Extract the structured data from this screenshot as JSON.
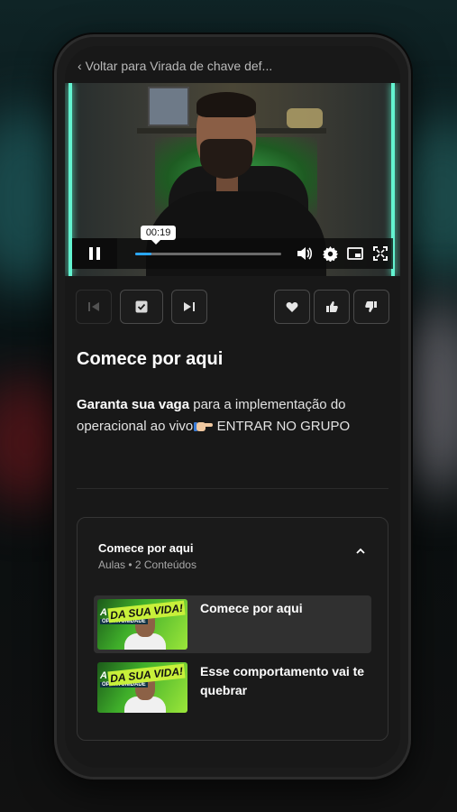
{
  "header": {
    "back_label": "Voltar para Virada de chave def..."
  },
  "video": {
    "current_time": "00:19",
    "progress": 0.11
  },
  "actions": {
    "prev": "previous-lesson",
    "complete": "mark-complete",
    "next": "next-lesson",
    "favorite": "favorite",
    "like": "like",
    "dislike": "dislike"
  },
  "lesson": {
    "title": "Comece por aqui",
    "description_bold": "Garanta sua vaga",
    "description_rest": " para a implementação do operacional ao vivo",
    "description_cta": " ENTRAR NO GRUPO"
  },
  "module": {
    "title": "Comece por aqui",
    "subtitle": "Aulas • 2 Conteúdos",
    "lessons": [
      {
        "label": "Comece por aqui",
        "active": true,
        "thumb_line1": "A MAIOR",
        "thumb_line2": "OPORTUNIDADE",
        "thumb_badge": "DA SUA VIDA!"
      },
      {
        "label": "Esse comportamento vai te quebrar",
        "active": false,
        "thumb_line1": "A MAIOR",
        "thumb_line2": "OPORTUNIDADE",
        "thumb_badge": "DA SUA VIDA!"
      }
    ]
  },
  "colors": {
    "accent_progress": "#2aa7ff",
    "thumb_green": "#3fae2a",
    "screen_bg": "#181818"
  }
}
